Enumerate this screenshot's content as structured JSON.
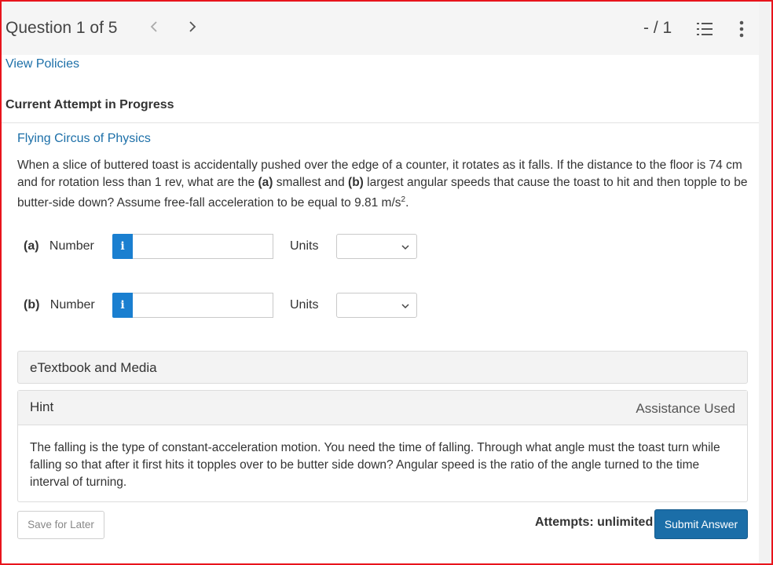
{
  "header": {
    "question_label": "Question 1 of 5",
    "prev_icon": "chevron-left-icon",
    "next_icon": "chevron-right-icon",
    "score": "- / 1",
    "list_icon": "question-list-icon",
    "more_icon": "more-vertical-icon"
  },
  "policies_link": "View Policies",
  "attempt_heading": "Current Attempt in Progress",
  "subject": "Flying Circus of Physics",
  "question": {
    "text_1": "When a slice of buttered toast is accidentally pushed over the edge of a counter, it rotates as it falls. If the distance to the floor is 74 cm and for rotation less than 1 rev, what are the ",
    "bold_a": "(a)",
    "text_2": " smallest and ",
    "bold_b": "(b)",
    "text_3": " largest angular speeds that cause the toast to hit and then topple to be butter-side down? Assume free-fall acceleration to be equal to 9.81 m/s",
    "sup": "2",
    "text_4": "."
  },
  "parts": [
    {
      "letter": "(a)",
      "label": "Number",
      "info": "i",
      "value": "",
      "units_label": "Units",
      "units_value": ""
    },
    {
      "letter": "(b)",
      "label": "Number",
      "info": "i",
      "value": "",
      "units_label": "Units",
      "units_value": ""
    }
  ],
  "etextbook": "eTextbook and Media",
  "hint": {
    "title": "Hint",
    "status": "Assistance Used",
    "text": "The falling is the type of constant-acceleration motion. You need the time of falling. Through what angle must the toast turn while falling so that after it first hits it topples over to be butter side down? Angular speed is the ratio of the angle turned to the time interval of turning."
  },
  "footer": {
    "save_label": "Save for Later",
    "attempts": "Attempts: unlimited",
    "submit_label": "Submit Answer"
  },
  "colors": {
    "link": "#1c6fa8",
    "primary_button": "#1b6ea8",
    "info_button": "#1a7fd0",
    "frame_border": "#e8141c"
  }
}
